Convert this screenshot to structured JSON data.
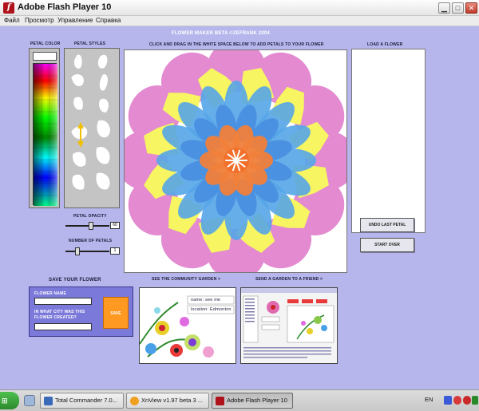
{
  "window": {
    "title": "Adobe Flash Player 10"
  },
  "menu": {
    "items": [
      "Файл",
      "Просмотр",
      "Управление",
      "Справка"
    ]
  },
  "app": {
    "title": "FLOWER MAKER BETA ©ZEFRANK 2004",
    "instruction": "CLICK AND DRAG IN THE WHITE SPACE BELOW  TO ADD PETALS TO YOUR FLOWER",
    "petal_color_label": "PETAL COLOR",
    "petal_styles_label": "PETAL STYLES",
    "load_label": "LOAD A FLOWER",
    "petal_opacity_label": "PETAL OPACITY",
    "petal_opacity_value": "60",
    "petal_opacity_level": 0.6,
    "number_of_petals_label": "NUMBER OF PETALS",
    "number_of_petals_value": "1",
    "number_of_petals_level": 0.25,
    "undo_label": "UNDO LAST PETAL",
    "start_over_label": "START OVER",
    "save_title": "SAVE YOUR FLOWER",
    "flower_name_label": "FLOWER NAME",
    "city_label_1": "IN WHAT CITY WAS THIS",
    "city_label_2": "FLOWER CREATED?",
    "save_button": "SAVE",
    "garden_link": "SEE THE COMMUNITY GARDEN >",
    "send_link": "SEND A GARDEN TO A FRIEND >",
    "garden_thumb_name": "name: see me",
    "garden_thumb_location": "location: Edmonton"
  },
  "colors": {
    "palette_columns": [
      "#ffffff",
      "#ff0000",
      "#ff8800",
      "#ffff00",
      "#88ff00",
      "#00ff88",
      "#00ffff",
      "#0088ff",
      "#0000ff",
      "#8800ff",
      "#ff00ff",
      "#000000"
    ]
  },
  "taskbar": {
    "items": [
      {
        "label": "Total Commander 7.0...",
        "icon": "floppy-icon"
      },
      {
        "label": "XnView v1.97 beta 3 ...",
        "icon": "xnview-icon"
      },
      {
        "label": "Adobe Flash Player 10",
        "icon": "flash-icon",
        "active": true
      }
    ],
    "language": "EN"
  }
}
